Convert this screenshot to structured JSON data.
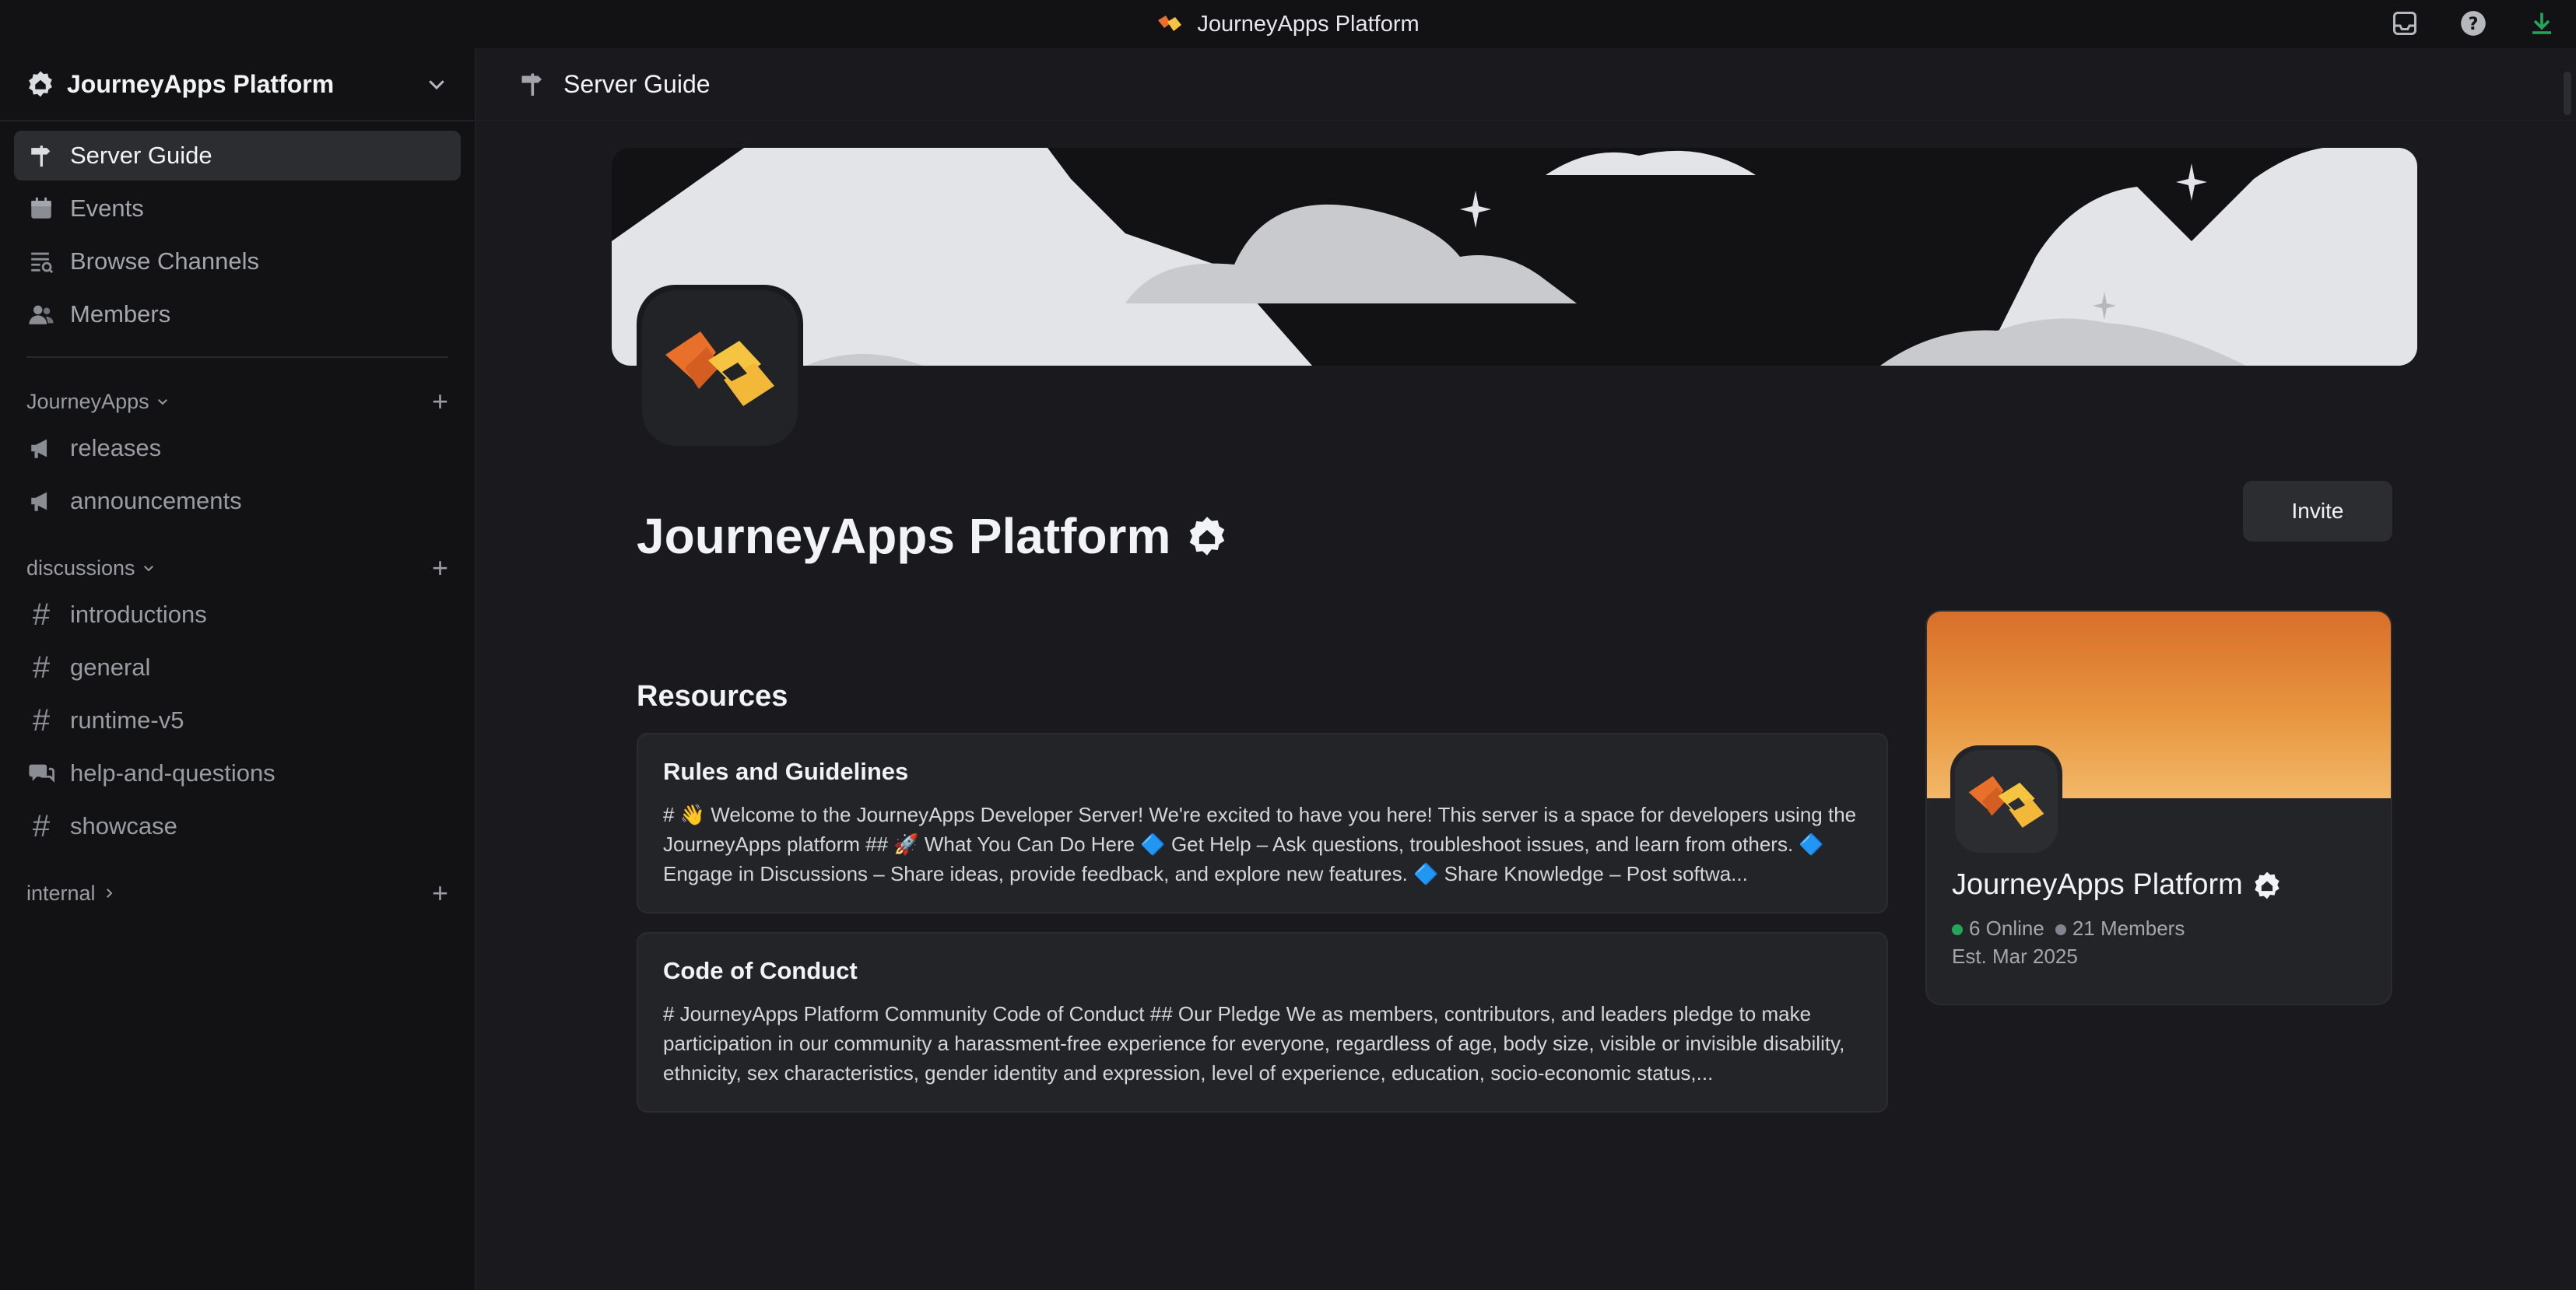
{
  "titlebar": {
    "title": "JourneyApps Platform",
    "icons": [
      "inbox-icon",
      "help-icon",
      "download-icon"
    ]
  },
  "sidebar": {
    "server_name": "JourneyApps Platform",
    "nav": [
      {
        "label": "Server Guide",
        "icon": "signpost-icon",
        "active": true
      },
      {
        "label": "Events",
        "icon": "calendar-icon"
      },
      {
        "label": "Browse Channels",
        "icon": "browse-channels-icon"
      },
      {
        "label": "Members",
        "icon": "members-icon"
      }
    ],
    "categories": [
      {
        "label": "JourneyApps",
        "expanded": true,
        "channels": [
          {
            "name": "releases",
            "icon": "announcement-icon"
          },
          {
            "name": "announcements",
            "icon": "announcement-icon"
          }
        ]
      },
      {
        "label": "discussions",
        "expanded": true,
        "channels": [
          {
            "name": "introductions",
            "icon": "hash-icon"
          },
          {
            "name": "general",
            "icon": "hash-icon"
          },
          {
            "name": "runtime-v5",
            "icon": "hash-icon"
          },
          {
            "name": "help-and-questions",
            "icon": "forum-icon"
          },
          {
            "name": "showcase",
            "icon": "hash-icon"
          }
        ]
      },
      {
        "label": "internal",
        "expanded": false,
        "channels": []
      }
    ]
  },
  "main": {
    "header_title": "Server Guide",
    "server_title": "JourneyApps Platform",
    "invite_label": "Invite",
    "resources_title": "Resources",
    "resources": [
      {
        "title": "Rules and Guidelines",
        "body": "# 👋 Welcome to the JourneyApps Developer Server! We're excited to have you here! This server is a space for developers using the JourneyApps platform ## 🚀 What You Can Do Here 🔷 Get Help – Ask questions, troubleshoot issues, and learn from others. 🔷 Engage in Discussions – Share ideas, provide feedback, and explore new features. 🔷 Share Knowledge – Post softwa..."
      },
      {
        "title": "Code of Conduct",
        "body": "# JourneyApps Platform Community Code of Conduct ## Our Pledge We as members, contributors, and leaders pledge to make participation in our community a harassment-free experience for everyone, regardless of age, body size, visible or invisible disability, ethnicity, sex characteristics, gender identity and expression, level of experience, education, socio-economic status,..."
      }
    ],
    "profile": {
      "name": "JourneyApps Platform",
      "online": "6 Online",
      "members": "21 Members",
      "established": "Est. Mar 2025"
    }
  },
  "colors": {
    "online": "#23a55a",
    "offline": "#80848e",
    "accent_orange": "#e8953f"
  }
}
